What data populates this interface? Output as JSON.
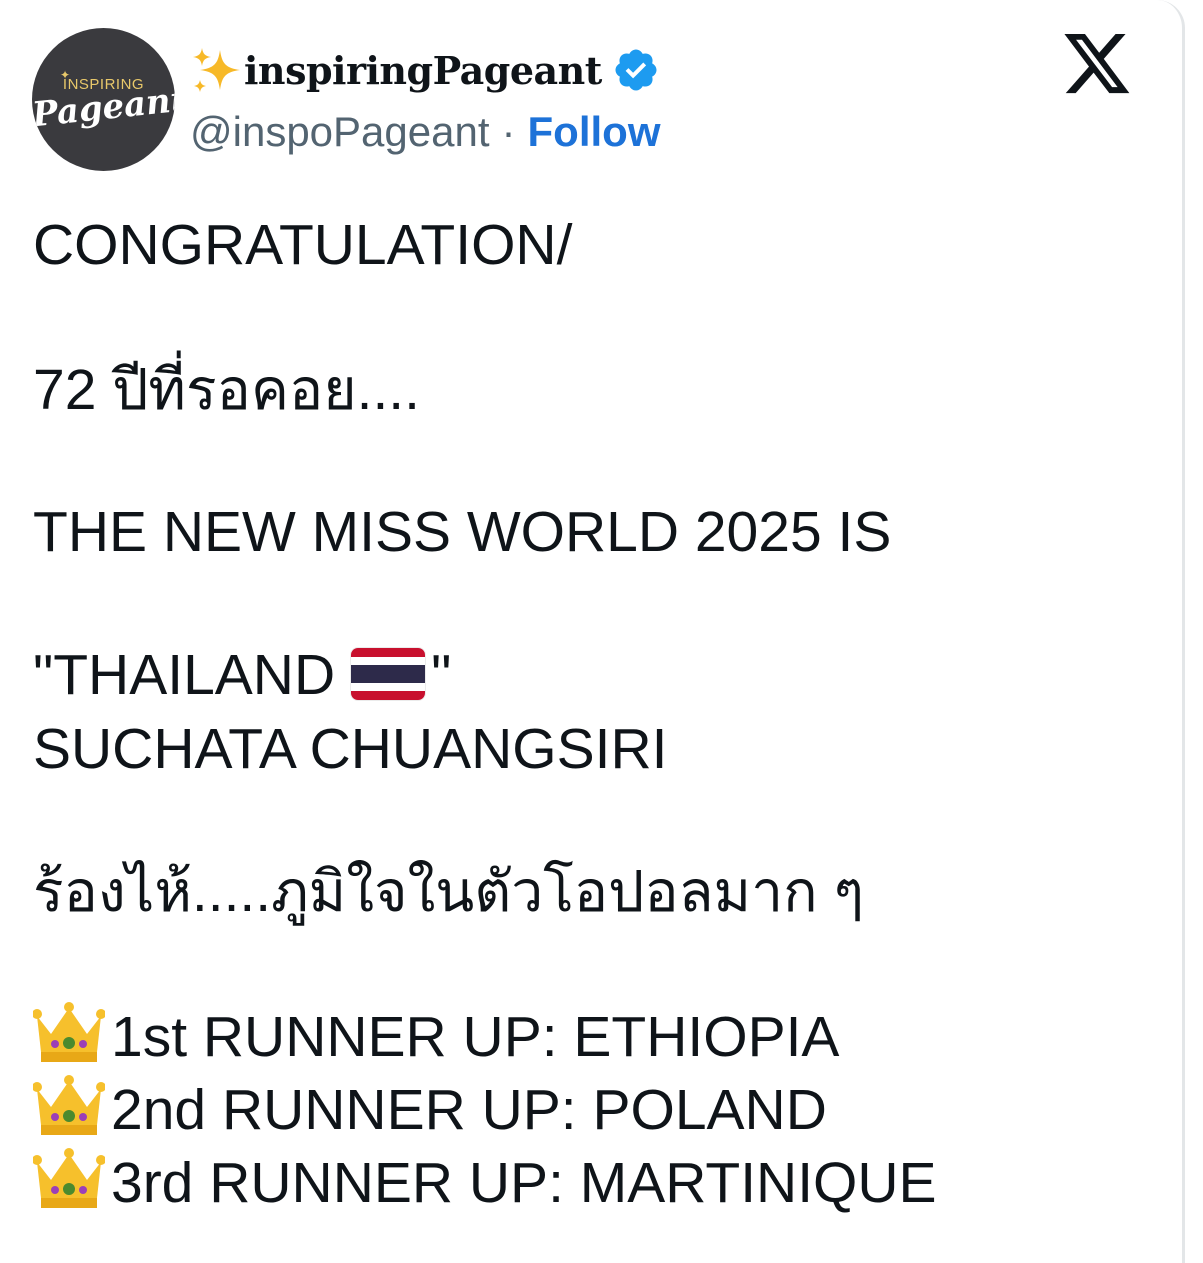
{
  "window": {
    "title": "X post"
  },
  "author": {
    "display_name": "inspiringPageant",
    "handle": "@inspoPageant",
    "separator": "·",
    "follow_label": "Follow",
    "avatar_logo_top": "INSPIRING",
    "avatar_logo_main": "Pageant",
    "verified": true,
    "verified_color": "#1d9bf0"
  },
  "icons": {
    "name_prefix": "sparkles-icon",
    "verified": "verified-badge-icon",
    "close": "x-logo-icon",
    "flag": "thailand-flag-icon",
    "runner_up": "crown-icon"
  },
  "post": {
    "line1": "CONGRATULATION/",
    "line2": "72 ปีที่รอคอย....",
    "line3": "THE NEW MISS WORLD 2025 IS",
    "line4_open": "\"THAILAND",
    "line4_close": "\"",
    "line5": "SUCHATA CHUANGSIRI",
    "line6": "ร้องไห้.....ภูมิใจในตัวโอปอลมาก ๆ",
    "runners_up": [
      "1st RUNNER UP: ETHIOPIA",
      "2nd RUNNER UP: POLAND",
      "3rd RUNNER UP:  MARTINIQUE"
    ]
  },
  "colors": {
    "text": "#0f1419",
    "secondary": "#536471",
    "follow": "#1d72d8"
  }
}
